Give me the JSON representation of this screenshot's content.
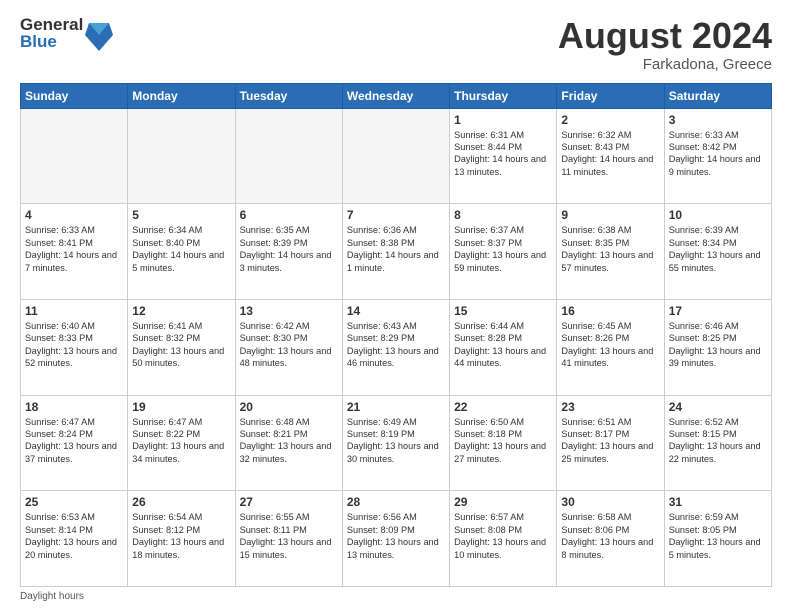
{
  "logo": {
    "general": "General",
    "blue": "Blue"
  },
  "header": {
    "month": "August 2024",
    "location": "Farkadona, Greece"
  },
  "weekdays": [
    "Sunday",
    "Monday",
    "Tuesday",
    "Wednesday",
    "Thursday",
    "Friday",
    "Saturday"
  ],
  "weeks": [
    [
      {
        "day": "",
        "sunrise": "",
        "sunset": "",
        "daylight": "",
        "empty": true
      },
      {
        "day": "",
        "sunrise": "",
        "sunset": "",
        "daylight": "",
        "empty": true
      },
      {
        "day": "",
        "sunrise": "",
        "sunset": "",
        "daylight": "",
        "empty": true
      },
      {
        "day": "",
        "sunrise": "",
        "sunset": "",
        "daylight": "",
        "empty": true
      },
      {
        "day": "1",
        "sunrise": "Sunrise: 6:31 AM",
        "sunset": "Sunset: 8:44 PM",
        "daylight": "Daylight: 14 hours and 13 minutes.",
        "empty": false
      },
      {
        "day": "2",
        "sunrise": "Sunrise: 6:32 AM",
        "sunset": "Sunset: 8:43 PM",
        "daylight": "Daylight: 14 hours and 11 minutes.",
        "empty": false
      },
      {
        "day": "3",
        "sunrise": "Sunrise: 6:33 AM",
        "sunset": "Sunset: 8:42 PM",
        "daylight": "Daylight: 14 hours and 9 minutes.",
        "empty": false
      }
    ],
    [
      {
        "day": "4",
        "sunrise": "Sunrise: 6:33 AM",
        "sunset": "Sunset: 8:41 PM",
        "daylight": "Daylight: 14 hours and 7 minutes.",
        "empty": false
      },
      {
        "day": "5",
        "sunrise": "Sunrise: 6:34 AM",
        "sunset": "Sunset: 8:40 PM",
        "daylight": "Daylight: 14 hours and 5 minutes.",
        "empty": false
      },
      {
        "day": "6",
        "sunrise": "Sunrise: 6:35 AM",
        "sunset": "Sunset: 8:39 PM",
        "daylight": "Daylight: 14 hours and 3 minutes.",
        "empty": false
      },
      {
        "day": "7",
        "sunrise": "Sunrise: 6:36 AM",
        "sunset": "Sunset: 8:38 PM",
        "daylight": "Daylight: 14 hours and 1 minute.",
        "empty": false
      },
      {
        "day": "8",
        "sunrise": "Sunrise: 6:37 AM",
        "sunset": "Sunset: 8:37 PM",
        "daylight": "Daylight: 13 hours and 59 minutes.",
        "empty": false
      },
      {
        "day": "9",
        "sunrise": "Sunrise: 6:38 AM",
        "sunset": "Sunset: 8:35 PM",
        "daylight": "Daylight: 13 hours and 57 minutes.",
        "empty": false
      },
      {
        "day": "10",
        "sunrise": "Sunrise: 6:39 AM",
        "sunset": "Sunset: 8:34 PM",
        "daylight": "Daylight: 13 hours and 55 minutes.",
        "empty": false
      }
    ],
    [
      {
        "day": "11",
        "sunrise": "Sunrise: 6:40 AM",
        "sunset": "Sunset: 8:33 PM",
        "daylight": "Daylight: 13 hours and 52 minutes.",
        "empty": false
      },
      {
        "day": "12",
        "sunrise": "Sunrise: 6:41 AM",
        "sunset": "Sunset: 8:32 PM",
        "daylight": "Daylight: 13 hours and 50 minutes.",
        "empty": false
      },
      {
        "day": "13",
        "sunrise": "Sunrise: 6:42 AM",
        "sunset": "Sunset: 8:30 PM",
        "daylight": "Daylight: 13 hours and 48 minutes.",
        "empty": false
      },
      {
        "day": "14",
        "sunrise": "Sunrise: 6:43 AM",
        "sunset": "Sunset: 8:29 PM",
        "daylight": "Daylight: 13 hours and 46 minutes.",
        "empty": false
      },
      {
        "day": "15",
        "sunrise": "Sunrise: 6:44 AM",
        "sunset": "Sunset: 8:28 PM",
        "daylight": "Daylight: 13 hours and 44 minutes.",
        "empty": false
      },
      {
        "day": "16",
        "sunrise": "Sunrise: 6:45 AM",
        "sunset": "Sunset: 8:26 PM",
        "daylight": "Daylight: 13 hours and 41 minutes.",
        "empty": false
      },
      {
        "day": "17",
        "sunrise": "Sunrise: 6:46 AM",
        "sunset": "Sunset: 8:25 PM",
        "daylight": "Daylight: 13 hours and 39 minutes.",
        "empty": false
      }
    ],
    [
      {
        "day": "18",
        "sunrise": "Sunrise: 6:47 AM",
        "sunset": "Sunset: 8:24 PM",
        "daylight": "Daylight: 13 hours and 37 minutes.",
        "empty": false
      },
      {
        "day": "19",
        "sunrise": "Sunrise: 6:47 AM",
        "sunset": "Sunset: 8:22 PM",
        "daylight": "Daylight: 13 hours and 34 minutes.",
        "empty": false
      },
      {
        "day": "20",
        "sunrise": "Sunrise: 6:48 AM",
        "sunset": "Sunset: 8:21 PM",
        "daylight": "Daylight: 13 hours and 32 minutes.",
        "empty": false
      },
      {
        "day": "21",
        "sunrise": "Sunrise: 6:49 AM",
        "sunset": "Sunset: 8:19 PM",
        "daylight": "Daylight: 13 hours and 30 minutes.",
        "empty": false
      },
      {
        "day": "22",
        "sunrise": "Sunrise: 6:50 AM",
        "sunset": "Sunset: 8:18 PM",
        "daylight": "Daylight: 13 hours and 27 minutes.",
        "empty": false
      },
      {
        "day": "23",
        "sunrise": "Sunrise: 6:51 AM",
        "sunset": "Sunset: 8:17 PM",
        "daylight": "Daylight: 13 hours and 25 minutes.",
        "empty": false
      },
      {
        "day": "24",
        "sunrise": "Sunrise: 6:52 AM",
        "sunset": "Sunset: 8:15 PM",
        "daylight": "Daylight: 13 hours and 22 minutes.",
        "empty": false
      }
    ],
    [
      {
        "day": "25",
        "sunrise": "Sunrise: 6:53 AM",
        "sunset": "Sunset: 8:14 PM",
        "daylight": "Daylight: 13 hours and 20 minutes.",
        "empty": false
      },
      {
        "day": "26",
        "sunrise": "Sunrise: 6:54 AM",
        "sunset": "Sunset: 8:12 PM",
        "daylight": "Daylight: 13 hours and 18 minutes.",
        "empty": false
      },
      {
        "day": "27",
        "sunrise": "Sunrise: 6:55 AM",
        "sunset": "Sunset: 8:11 PM",
        "daylight": "Daylight: 13 hours and 15 minutes.",
        "empty": false
      },
      {
        "day": "28",
        "sunrise": "Sunrise: 6:56 AM",
        "sunset": "Sunset: 8:09 PM",
        "daylight": "Daylight: 13 hours and 13 minutes.",
        "empty": false
      },
      {
        "day": "29",
        "sunrise": "Sunrise: 6:57 AM",
        "sunset": "Sunset: 8:08 PM",
        "daylight": "Daylight: 13 hours and 10 minutes.",
        "empty": false
      },
      {
        "day": "30",
        "sunrise": "Sunrise: 6:58 AM",
        "sunset": "Sunset: 8:06 PM",
        "daylight": "Daylight: 13 hours and 8 minutes.",
        "empty": false
      },
      {
        "day": "31",
        "sunrise": "Sunrise: 6:59 AM",
        "sunset": "Sunset: 8:05 PM",
        "daylight": "Daylight: 13 hours and 5 minutes.",
        "empty": false
      }
    ]
  ],
  "footer": {
    "daylight_label": "Daylight hours"
  }
}
